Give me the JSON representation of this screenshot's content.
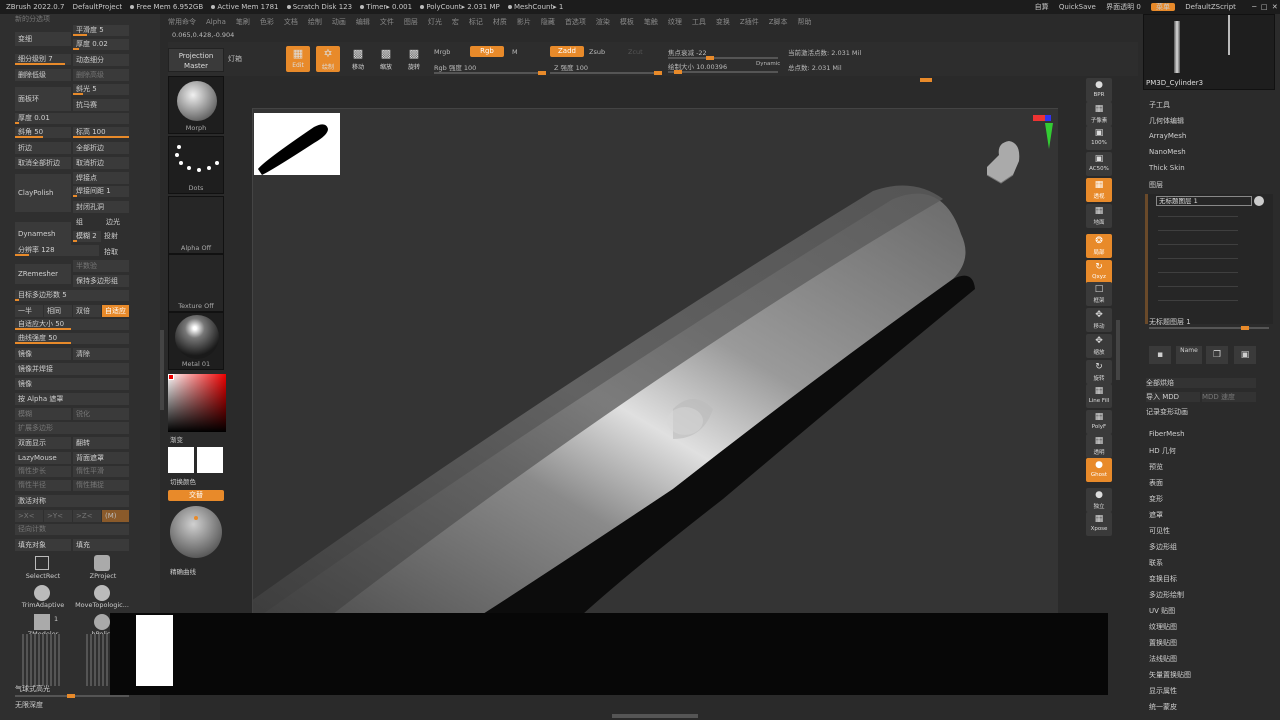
{
  "titlebar": {
    "app": "ZBrush 2022.0.7",
    "project": "DefaultProject",
    "free_mem": "Free Mem 6.952GB",
    "active_mem": "Active Mem 1781",
    "scratch": "Scratch Disk 123",
    "timer": "Timer▸ 0.001",
    "polycount": "PolyCount▸ 2.031 MP",
    "meshcount": "MeshCount▸ 1",
    "right": {
      "label1": "自算",
      "quicksave": "QuickSave",
      "transparency": "界面透明 0",
      "menu": "菜单",
      "script": "DefaultZScript"
    }
  },
  "menubar": [
    "常用命令",
    "Alpha",
    "笔刷",
    "色彩",
    "文档",
    "绘制",
    "动画",
    "编辑",
    "文件",
    "图层",
    "灯光",
    "宏",
    "标记",
    "材质",
    "影片",
    "隐藏",
    "首选项",
    "渲染",
    "模板",
    "笔触",
    "纹理",
    "工具",
    "变换",
    "Z插件",
    "Z脚本",
    "帮助"
  ],
  "coord": "0.065,0.428,-0.904",
  "toolbar": {
    "projection_master": "Projection Master",
    "lightbox": "灯箱",
    "edit": "Edit",
    "draw": "绘制",
    "move": "移动",
    "scale": "缩放",
    "rotate": "旋转",
    "mrgb": "Mrgb",
    "rgb": "Rgb",
    "m": "M",
    "rgb_intensity": "Rgb 强度 100",
    "zadd": "Zadd",
    "zsub": "Zsub",
    "zcut": "Zcut",
    "z_intensity": "Z 强度 100",
    "focal_shift": "焦点衰减 -22",
    "draw_size": "绘制大小 10.00396",
    "dynamic": "Dynamic",
    "active_points": "当前激活点数: 2.031 Mil",
    "total_points": "总点数: 2.031 Mil"
  },
  "left": {
    "top_label": "新的分选项",
    "smooth": "平滑度 5",
    "divide": "变细",
    "thickness": "厚度 0.02",
    "subdiv": "细分级别 7",
    "dyn_sub": "动态细分",
    "del_lower": "删除低级",
    "del_higher": "删除高级",
    "panel_loops": "面板环",
    "bevel5": "斜光 5",
    "polish": "抗马赛",
    "thickness2": "厚度 0.01",
    "bevel50": "斜角 50",
    "elevation": "标高 100",
    "crease": "折边",
    "crease_all": "全部折边",
    "uncrease_all": "取消全部折边",
    "uncrease": "取消折边",
    "claypolish": "ClayPolish",
    "weld": "焊接点",
    "weld_dist": "焊接间距 1",
    "close_holes": "封闭孔洞",
    "group": "组",
    "edge_light": "边光",
    "dynamesh": "Dynamesh",
    "blur": "模糊 2",
    "project": "投射",
    "resolution": "分辨率 128",
    "pick": "拾取",
    "zremesher": "ZRemesher",
    "half": "半数验",
    "keep_poly": "保持多边形组",
    "target_poly": "目标多边形数 5",
    "one_half": "一半",
    "same": "相同",
    "double": "双倍",
    "adaptive": "自适应",
    "adaptive_size": "自适应大小 50",
    "curve_strength": "曲线强度 50",
    "mirror": "镜像",
    "clear": "清除",
    "mirror_weld": "镜像并焊接",
    "mirror2": "镜像",
    "by_alpha": "按 Alpha 遮罩",
    "blur2": "模糊",
    "sharpen": "锐化",
    "expand_poly": "扩展多边形",
    "double_side": "双面显示",
    "flip": "翻转",
    "lazymouse": "LazyMouse",
    "backface": "背面遮罩",
    "lazy_step": "惰性步长",
    "lazy_smooth": "惰性平滑",
    "lazy_radius": "惰性半径",
    "lazy_snap": "惰性捕捉",
    "activate_sym": "激活对称",
    "x": ">X<",
    "y": ">Y<",
    "z": ">Z<",
    "m_label": "(M)",
    "radial": "径向计数",
    "fill_obj": "填充对象",
    "fill": "填充",
    "selectrect": "SelectRect",
    "zproject": "ZProject",
    "trimadaptive": "TrimAdaptive",
    "movetopo": "MoveTopologic...",
    "zmodeler": "ZModeler",
    "num1": "1",
    "ipolish": "hPolish",
    "bubble": "气球式高光",
    "infinite": "无限深度"
  },
  "brushcol": {
    "morph": "Morph",
    "dots": "Dots",
    "alpha_off": "Alpha Off",
    "texture_off": "Texture Off",
    "metal": "Metal 01",
    "gradient": "渐变",
    "switch_color": "切换颜色",
    "alternate": "交替",
    "curve_label": "精确曲线"
  },
  "shelf": {
    "bpr": "BPR",
    "subpix": "子像素",
    "zoom100": "100%",
    "ac50": "AC50%",
    "persp": "透视",
    "floor": "地面",
    "local": "局部",
    "xyz": "Qxyz",
    "frame": "框架",
    "move": "移动",
    "scale": "缩放",
    "rotate": "旋转",
    "linefill": "Line Fill",
    "polyf": "PolyF",
    "transp": "透明",
    "ghost": "Ghost",
    "solo": "独立",
    "xpose": "Xpose"
  },
  "right": {
    "mesh_name": "PM3D_Cylinder3",
    "items_top": [
      "子工具",
      "几何体编辑",
      "ArrayMesh",
      "NanoMesh",
      "Thick Skin",
      "图层"
    ],
    "layer_name": "无标题图层 1",
    "layer_name2": "无标题图层 1",
    "name_btn": "Name",
    "bake_all": "全部烘焙",
    "import_mdd": "导入 MDD",
    "mdd_speed": "MDD 速度",
    "record_morph": "记录变形动画",
    "items_bottom": [
      "FiberMesh",
      "HD 几何",
      "预览",
      "表面",
      "变形",
      "遮罩",
      "可见性",
      "多边形组",
      "联系",
      "变换目标",
      "多边形绘制",
      "UV 贴图",
      "纹理贴图",
      "置换贴图",
      "法线贴图",
      "矢量置换贴图",
      "显示属性",
      "统一蒙皮"
    ]
  },
  "colors": {
    "accent": "#e88a2a",
    "bg": "#2a2a2a",
    "panel": "#2f2f2f"
  }
}
